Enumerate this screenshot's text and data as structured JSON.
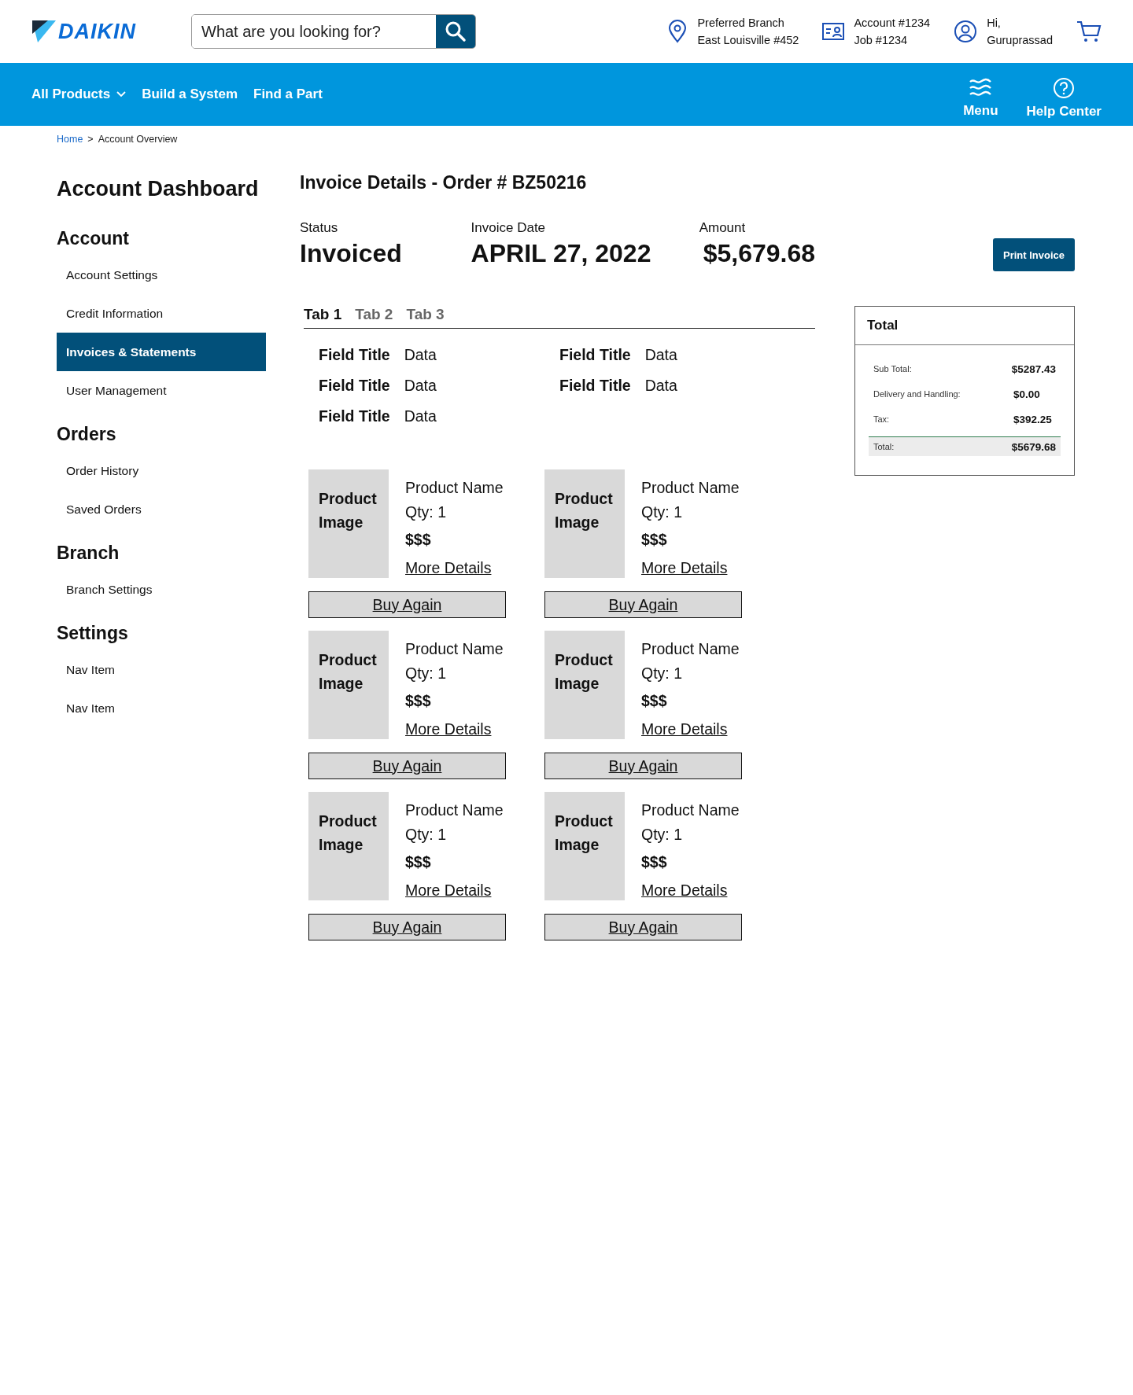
{
  "header": {
    "logo": "DAIKIN",
    "search": {
      "placeholder": "What are you looking for?"
    },
    "branch": {
      "label": "Preferred Branch",
      "value": "East Louisville #452"
    },
    "account": {
      "label": "Account #1234",
      "value": "Job #1234"
    },
    "user": {
      "label": "Hi,",
      "value": "Guruprassad"
    }
  },
  "nav": {
    "items": [
      {
        "label": "All Products",
        "dropdown": true
      },
      {
        "label": "Build a System",
        "dropdown": false
      },
      {
        "label": "Find a Part",
        "dropdown": false
      }
    ],
    "menu": "Menu",
    "help": "Help Center"
  },
  "breadcrumb": [
    {
      "label": "Home",
      "link": true
    },
    {
      "label": "Account Overview",
      "link": false
    }
  ],
  "breadcrumb_separator": ">",
  "sidebar": {
    "title": "Account Dashboard",
    "sections": [
      {
        "title": "Account",
        "items": [
          {
            "label": "Account Settings",
            "selected": false
          },
          {
            "label": "Credit Information",
            "selected": false
          },
          {
            "label": "Invoices & Statements",
            "selected": true
          },
          {
            "label": "User Management",
            "selected": false
          }
        ]
      },
      {
        "title": "Orders",
        "items": [
          {
            "label": "Order History",
            "selected": false
          },
          {
            "label": "Saved Orders",
            "selected": false
          }
        ]
      },
      {
        "title": "Branch",
        "items": [
          {
            "label": "Branch Settings",
            "selected": false
          }
        ]
      },
      {
        "title": "Settings",
        "items": [
          {
            "label": "Nav Item",
            "selected": false
          },
          {
            "label": "Nav Item",
            "selected": false
          }
        ]
      }
    ]
  },
  "invoice": {
    "title": "Invoice Details - Order # BZ50216",
    "summary": [
      {
        "label": "Status",
        "value": "Invoiced"
      },
      {
        "label": "Invoice Date",
        "value": "APRIL 27, 2022"
      },
      {
        "label": "Amount",
        "value": "$5,679.68"
      }
    ],
    "print_button": "Print Invoice",
    "tabs": [
      {
        "label": "Tab 1",
        "selected": true
      },
      {
        "label": "Tab 2",
        "selected": false
      },
      {
        "label": "Tab 3",
        "selected": false
      }
    ],
    "fields": [
      [
        {
          "title": "Field Title",
          "data": "Data"
        },
        {
          "title": "Field Title",
          "data": "Data"
        },
        {
          "title": "Field Title",
          "data": "Data"
        }
      ],
      [
        {
          "title": "Field Title",
          "data": "Data"
        },
        {
          "title": "Field Title",
          "data": "Data"
        }
      ]
    ],
    "products": [
      {
        "image": "Product Image",
        "name": "Product Name",
        "qty": "Qty: 1",
        "price": "$$$",
        "link": "More Details",
        "button": "Buy Again"
      },
      {
        "image": "Product Image",
        "name": "Product Name",
        "qty": "Qty: 1",
        "price": "$$$",
        "link": "More Details",
        "button": "Buy Again"
      },
      {
        "image": "Product Image",
        "name": "Product Name",
        "qty": "Qty: 1",
        "price": "$$$",
        "link": "More Details",
        "button": "Buy Again"
      },
      {
        "image": "Product Image",
        "name": "Product Name",
        "qty": "Qty: 1",
        "price": "$$$",
        "link": "More Details",
        "button": "Buy Again"
      },
      {
        "image": "Product Image",
        "name": "Product Name",
        "qty": "Qty: 1",
        "price": "$$$",
        "link": "More Details",
        "button": "Buy Again"
      },
      {
        "image": "Product Image",
        "name": "Product Name",
        "qty": "Qty: 1",
        "price": "$$$",
        "link": "More Details",
        "button": "Buy Again"
      }
    ]
  },
  "totals": {
    "title": "Total",
    "rows": [
      {
        "label": "Sub Total:",
        "value": "$5287.43",
        "kind": "line"
      },
      {
        "label": "Delivery and Handling:",
        "value": "$0.00",
        "kind": "line"
      },
      {
        "label": "Tax:",
        "value": "$392.25",
        "kind": "line"
      },
      {
        "label": "Total:",
        "value": "$5679.68",
        "kind": "total"
      }
    ]
  }
}
